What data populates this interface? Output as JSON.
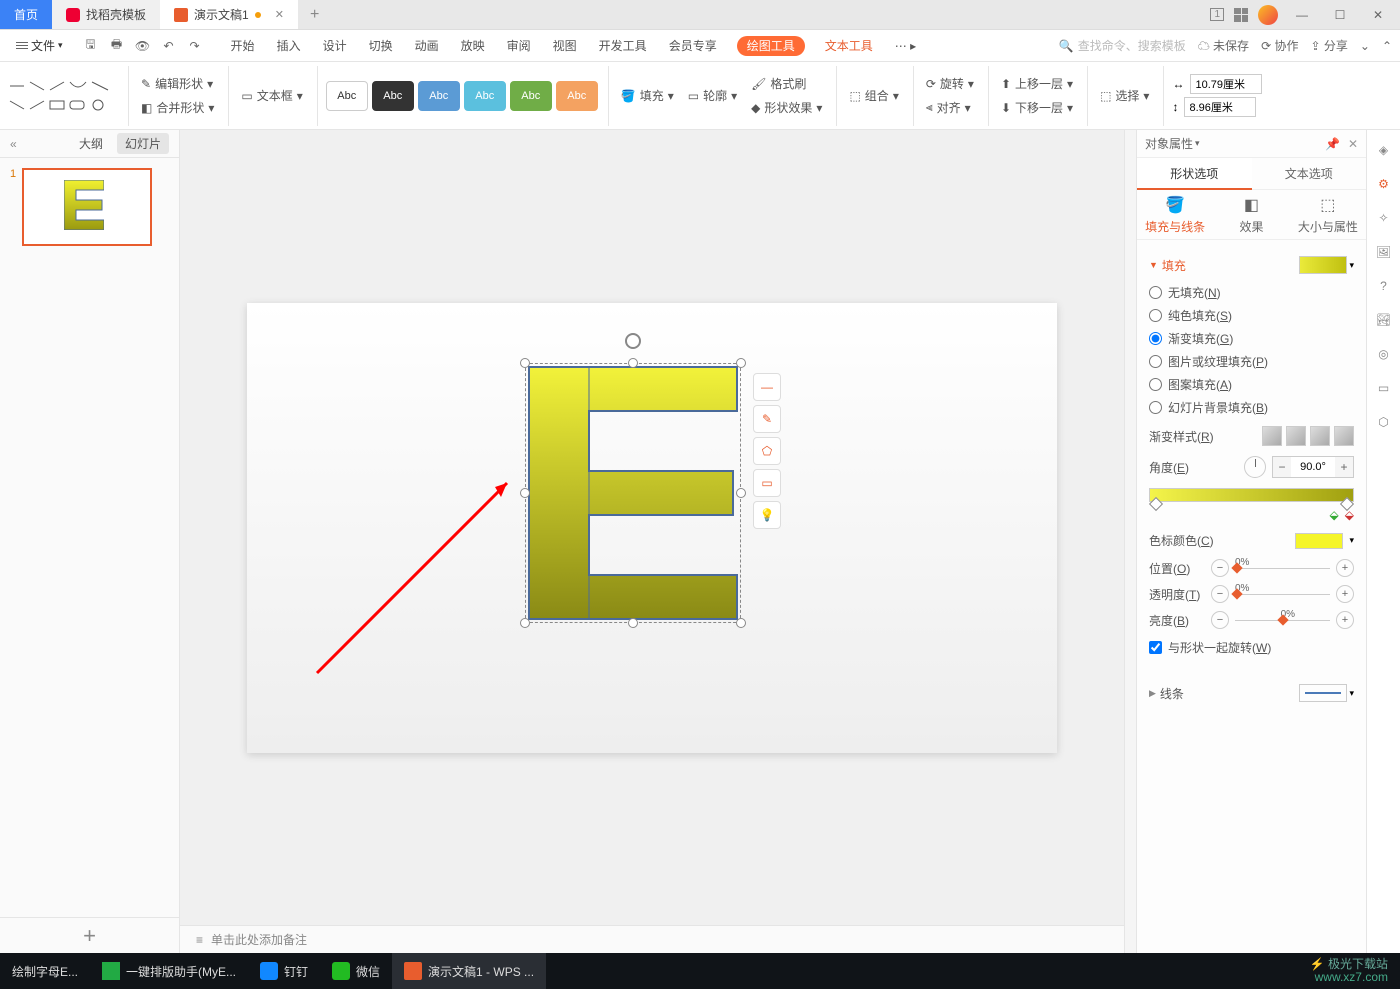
{
  "tabs": {
    "home": "首页",
    "template": "找稻壳模板",
    "doc": "演示文稿1"
  },
  "file_label": "文件",
  "menu": [
    "开始",
    "插入",
    "设计",
    "切换",
    "动画",
    "放映",
    "审阅",
    "视图",
    "开发工具",
    "会员专享",
    "绘图工具",
    "文本工具"
  ],
  "search_placeholder": "查找命令、搜索模板",
  "header_right": {
    "unsaved": "未保存",
    "coop": "协作",
    "share": "分享"
  },
  "ribbon": {
    "edit_shape": "编辑形状",
    "textbox": "文本框",
    "merge": "合并形状",
    "swatch_label": "Abc",
    "fill": "填充",
    "outline": "轮廓",
    "format_painter": "格式刷",
    "effects": "形状效果",
    "group": "组合",
    "rotate": "旋转",
    "align": "对齐",
    "up_layer": "上移一层",
    "down_layer": "下移一层",
    "select": "选择",
    "width_val": "10.79厘米",
    "height_val": "8.96厘米"
  },
  "side": {
    "outline": "大纲",
    "slides": "幻灯片"
  },
  "thumb_index": "1",
  "notes_placeholder": "单击此处添加备注",
  "panel": {
    "title": "对象属性",
    "tab_shape": "形状选项",
    "tab_text": "文本选项",
    "sub_fill": "填充与线条",
    "sub_effect": "效果",
    "sub_size": "大小与属性",
    "fill_section": "填充",
    "line_section": "线条",
    "fill_options": {
      "none": "无填充(N)",
      "solid": "纯色填充(S)",
      "gradient": "渐变填充(G)",
      "picture": "图片或纹理填充(P)",
      "pattern": "图案填充(A)",
      "slide_bg": "幻灯片背景填充(B)"
    },
    "grad_style": "渐变样式(R)",
    "angle": "角度(E)",
    "angle_val": "90.0°",
    "stop_color": "色标颜色(C)",
    "position": "位置(O)",
    "pos_val": "0%",
    "transparency": "透明度(T)",
    "trans_val": "0%",
    "brightness": "亮度(B)",
    "bright_val": "0%",
    "rotate_with": "与形状一起旋转(W)"
  },
  "taskbar": {
    "t1": "绘制字母E...",
    "t2": "一键排版助手(MyE...",
    "t3": "钉钉",
    "t4": "微信",
    "t5": "演示文稿1 - WPS ...",
    "watermark_cn": "极光下载站",
    "watermark_url": "www.xz7.com"
  }
}
